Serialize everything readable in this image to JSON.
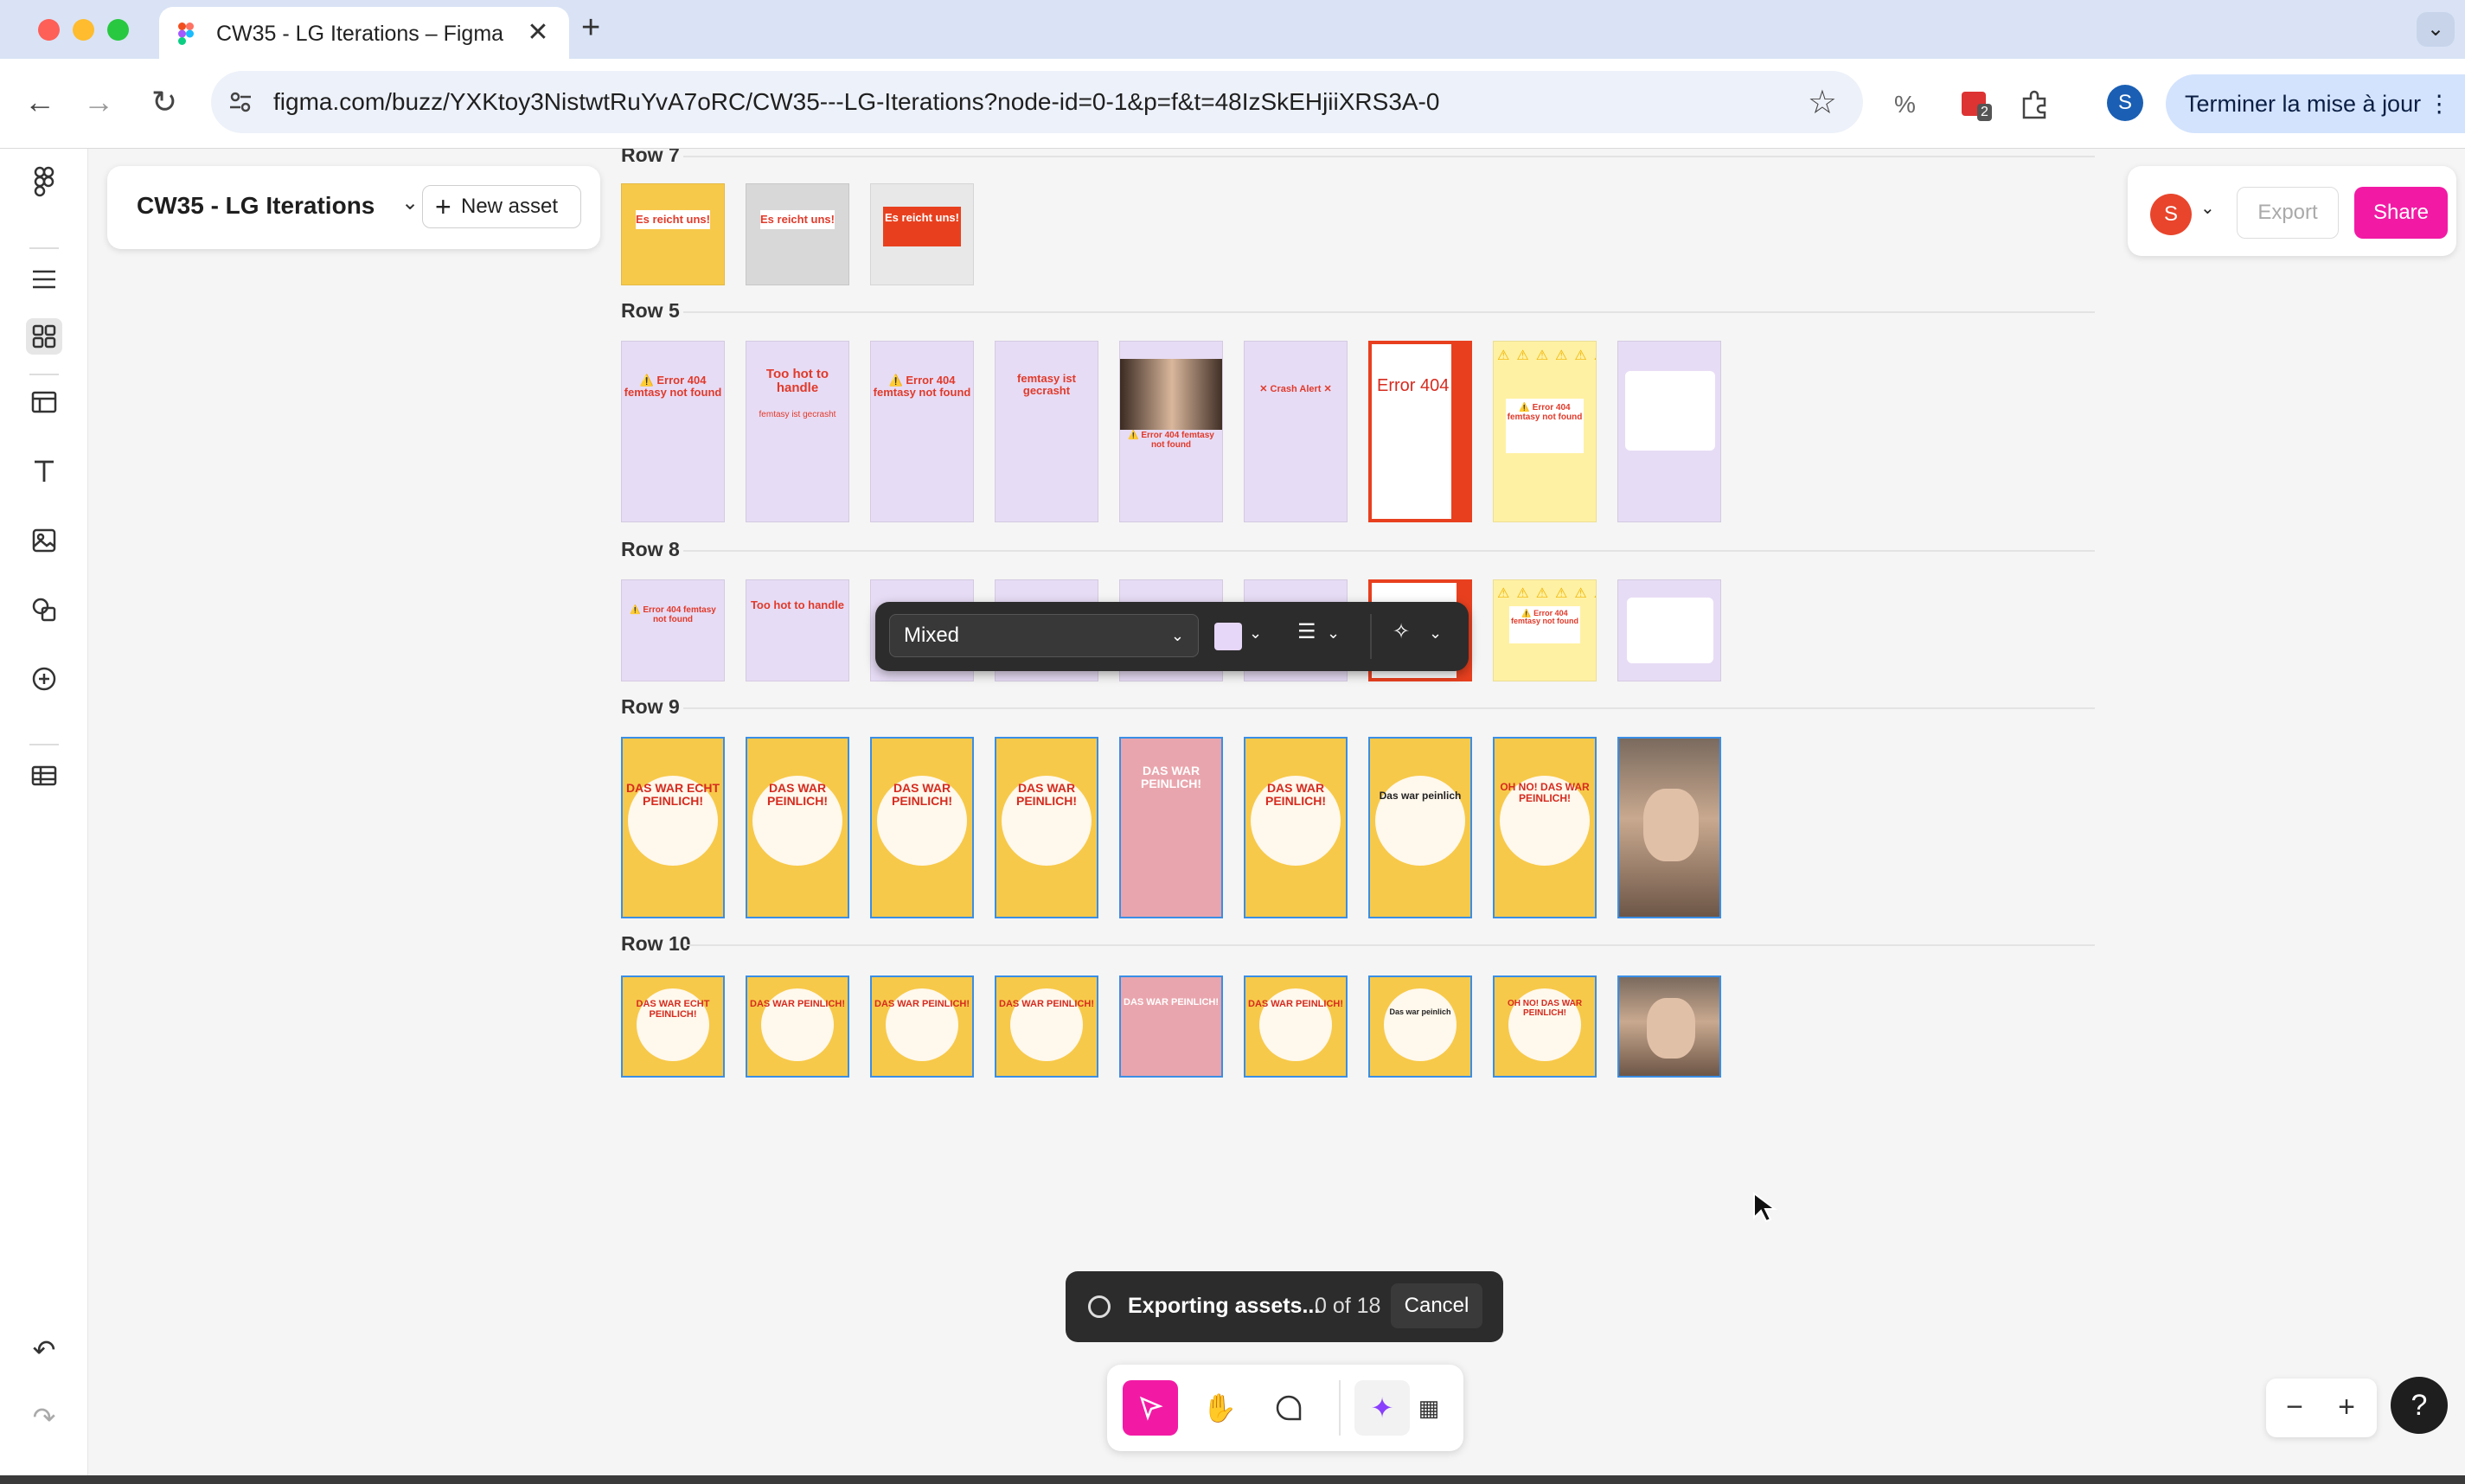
{
  "browser": {
    "tab_title": "CW35 - LG Iterations – Figma",
    "url": "figma.com/buzz/YXKtoy3NistwtRuYvA7oRC/CW35---LG-Iterations?node-id=0-1&p=f&t=48IzSkEHjiiXRS3A-0",
    "extension_badge": "2",
    "profile_initial": "S",
    "update_button": "Terminer la mise à jour"
  },
  "file": {
    "title": "CW35 - LG Iterations",
    "new_asset_label": "New asset"
  },
  "header": {
    "user_initial": "S",
    "export_label": "Export",
    "share_label": "Share"
  },
  "rows": [
    {
      "label": "Row 7"
    },
    {
      "label": "Row 5"
    },
    {
      "label": "Row 8"
    },
    {
      "label": "Row 9"
    },
    {
      "label": "Row 10"
    }
  ],
  "thumb_text": {
    "es_reicht": "Es reicht uns!",
    "error404": "⚠️ Error 404 femtasy not found",
    "too_hot": "Too hot to handle",
    "gecrasht": "femtasy ist gecrasht",
    "crash_alert": "✕ Crash Alert ✕",
    "error_big": "Error 404",
    "das_war_echt": "DAS WAR ECHT PEINLICH!",
    "das_war": "DAS WAR PEINLICH!",
    "das_war_peinlich": "Das war peinlich",
    "oh_no": "OH NO! DAS WAR PEINLICH!"
  },
  "context_toolbar": {
    "font_select_value": "Mixed",
    "fill_color": "#e6d6f7"
  },
  "toast": {
    "message": "Exporting assets...",
    "progress": "0 of 18",
    "cancel_label": "Cancel"
  },
  "zoom": {
    "minus": "−",
    "plus": "+",
    "help": "?"
  },
  "colors": {
    "accent": "#f21aa5",
    "selection": "#3a8ee6"
  }
}
